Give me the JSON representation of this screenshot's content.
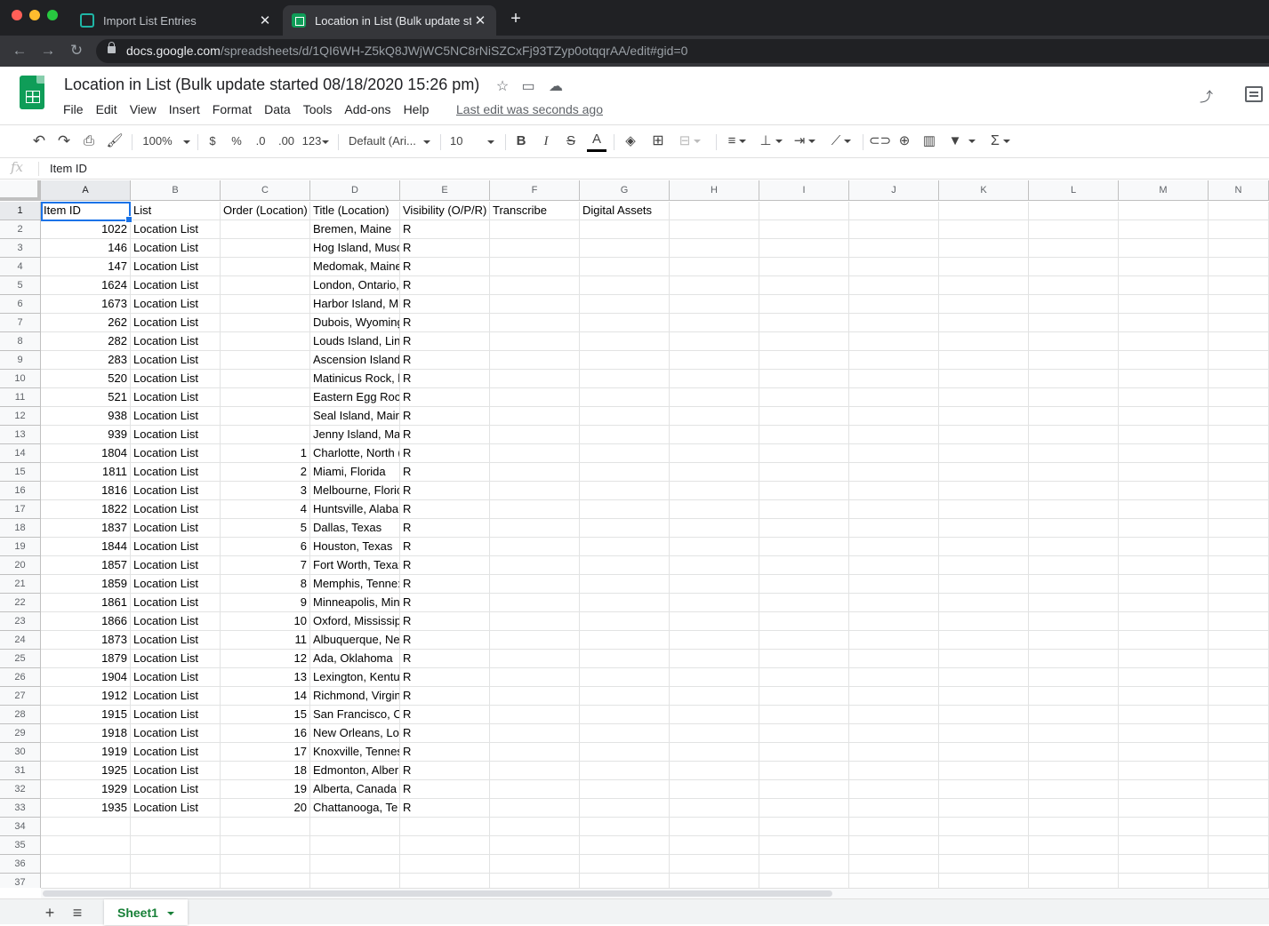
{
  "browser": {
    "tabs": [
      {
        "title": "Import List Entries",
        "active": false
      },
      {
        "title": "Location in List (Bulk update st",
        "active": true
      }
    ],
    "new_tab": "+",
    "url_host": "docs.google.com",
    "url_path": "/spreadsheets/d/1QI6WH-Z5kQ8JWjWC5NC8rNiSZCxFj93TZyp0otqqrAA/edit#gid=0"
  },
  "doc": {
    "title": "Location in List (Bulk update started 08/18/2020 15:26 pm)",
    "menu": [
      "File",
      "Edit",
      "View",
      "Insert",
      "Format",
      "Data",
      "Tools",
      "Add-ons",
      "Help"
    ],
    "last_edit": "Last edit was seconds ago"
  },
  "toolbar": {
    "zoom": "100%",
    "currency": "$",
    "percent": "%",
    "dec_less": ".0",
    "dec_more": ".00",
    "more_formats": "123",
    "font": "Default (Ari...",
    "font_size": "10",
    "bold": "B",
    "italic": "I",
    "strike": "S",
    "text_color": "A",
    "sigma": "Σ"
  },
  "formula_bar": {
    "fx": "fx",
    "value": "Item ID"
  },
  "columns": [
    "A",
    "B",
    "C",
    "D",
    "E",
    "F",
    "G",
    "H",
    "I",
    "J",
    "K",
    "L",
    "M",
    "N"
  ],
  "header_row": [
    "Item ID",
    "List",
    "Order (Location)",
    "Title (Location)",
    "Visibility (O/P/R)",
    "Transcribe",
    "Digital Assets"
  ],
  "rows": [
    [
      "1022",
      "Location List",
      "",
      "Bremen, Maine",
      "R"
    ],
    [
      "146",
      "Location List",
      "",
      "Hog Island, Musc",
      "R"
    ],
    [
      "147",
      "Location List",
      "",
      "Medomak, Maine",
      "R"
    ],
    [
      "1624",
      "Location List",
      "",
      "London, Ontario,",
      "R"
    ],
    [
      "1673",
      "Location List",
      "",
      "Harbor Island, M",
      "R"
    ],
    [
      "262",
      "Location List",
      "",
      "Dubois, Wyoming",
      "R"
    ],
    [
      "282",
      "Location List",
      "",
      "Louds Island, Lin",
      "R"
    ],
    [
      "283",
      "Location List",
      "",
      "Ascension Island",
      "R"
    ],
    [
      "520",
      "Location List",
      "",
      "Matinicus Rock, l",
      "R"
    ],
    [
      "521",
      "Location List",
      "",
      "Eastern Egg Roc",
      "R"
    ],
    [
      "938",
      "Location List",
      "",
      "Seal Island, Mair",
      "R"
    ],
    [
      "939",
      "Location List",
      "",
      "Jenny Island, Ma",
      "R"
    ],
    [
      "1804",
      "Location List",
      "1",
      "Charlotte, North (",
      "R"
    ],
    [
      "1811",
      "Location List",
      "2",
      "Miami, Florida",
      "R"
    ],
    [
      "1816",
      "Location List",
      "3",
      "Melbourne, Floric",
      "R"
    ],
    [
      "1822",
      "Location List",
      "4",
      "Huntsville, Alaba",
      "R"
    ],
    [
      "1837",
      "Location List",
      "5",
      "Dallas, Texas",
      "R"
    ],
    [
      "1844",
      "Location List",
      "6",
      "Houston, Texas",
      "R"
    ],
    [
      "1857",
      "Location List",
      "7",
      "Fort Worth, Texa:",
      "R"
    ],
    [
      "1859",
      "Location List",
      "8",
      "Memphis, Tenne:",
      "R"
    ],
    [
      "1861",
      "Location List",
      "9",
      "Minneapolis, Min",
      "R"
    ],
    [
      "1866",
      "Location List",
      "10",
      "Oxford, Mississip",
      "R"
    ],
    [
      "1873",
      "Location List",
      "11",
      "Albuquerque, Ne",
      "R"
    ],
    [
      "1879",
      "Location List",
      "12",
      "Ada, Oklahoma",
      "R"
    ],
    [
      "1904",
      "Location List",
      "13",
      "Lexington, Kentu",
      "R"
    ],
    [
      "1912",
      "Location List",
      "14",
      "Richmond, Virgin",
      "R"
    ],
    [
      "1915",
      "Location List",
      "15",
      "San Francisco, C",
      "R"
    ],
    [
      "1918",
      "Location List",
      "16",
      "New Orleans, Lo",
      "R"
    ],
    [
      "1919",
      "Location List",
      "17",
      "Knoxville, Tennes",
      "R"
    ],
    [
      "1925",
      "Location List",
      "18",
      "Edmonton, Alber",
      "R"
    ],
    [
      "1929",
      "Location List",
      "19",
      "Alberta, Canada",
      "R"
    ],
    [
      "1935",
      "Location List",
      "20",
      "Chattanooga, Te",
      "R"
    ]
  ],
  "row_numbers": [
    "1",
    "2",
    "3",
    "4",
    "5",
    "6",
    "7",
    "8",
    "9",
    "10",
    "11",
    "12",
    "13",
    "14",
    "15",
    "16",
    "17",
    "18",
    "19",
    "20",
    "21",
    "22",
    "23",
    "24",
    "25",
    "26",
    "27",
    "28",
    "29",
    "30",
    "31",
    "32",
    "33",
    "34",
    "35",
    "36",
    "37"
  ],
  "sheets": {
    "add": "+",
    "all": "≡",
    "active_sheet": "Sheet1"
  }
}
